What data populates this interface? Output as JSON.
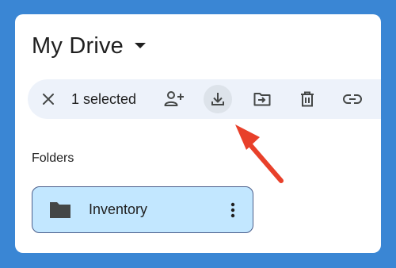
{
  "header": {
    "title": "My Drive",
    "menu_icon": "arrow-drop-down-icon"
  },
  "selection_toolbar": {
    "selected_label": "1 selected",
    "icons": [
      "close-icon",
      "share-person-add-icon",
      "download-icon",
      "move-folder-icon",
      "trash-icon",
      "link-icon"
    ],
    "highlighted": "download-icon"
  },
  "sections": {
    "folders_label": "Folders"
  },
  "folders": [
    {
      "name": "Inventory",
      "selected": true,
      "icon": "folder-icon",
      "menu_icon": "more-vertical-icon"
    }
  ],
  "annotation": {
    "type": "arrow",
    "color": "#e8402a",
    "points_to": "download-icon"
  },
  "colors": {
    "background": "#3a86d4",
    "toolbar": "#edf2fa",
    "selected_folder": "#c2e7ff",
    "text": "#1f1f1f"
  }
}
